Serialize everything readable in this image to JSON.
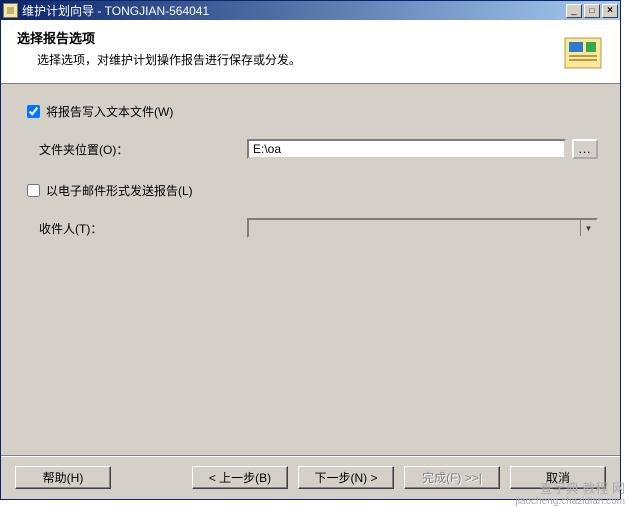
{
  "window": {
    "title": "维护计划向导 - TONGJIAN-564041",
    "minimize": "_",
    "maximize": "□",
    "close": "×"
  },
  "header": {
    "title": "选择报告选项",
    "description": "选择选项，对维护计划操作报告进行保存或分发。"
  },
  "options": {
    "write_report_checked": true,
    "write_report_label": "将报告写入文本文件(W)",
    "folder_label": "文件夹位置(O)：",
    "folder_value": "E:\\oa",
    "browse_label": "...",
    "email_report_checked": false,
    "email_report_label": "以电子邮件形式发送报告(L)",
    "recipient_label": "收件人(T)：",
    "recipient_value": ""
  },
  "buttons": {
    "help": "帮助(H)",
    "back": "< 上一步(B)",
    "next": "下一步(N) >",
    "finish": "完成(F) >>|",
    "cancel": "取消"
  },
  "watermark": {
    "line1": "查字典 教程 网",
    "line2": "jiaocheng.chazidian.com"
  }
}
